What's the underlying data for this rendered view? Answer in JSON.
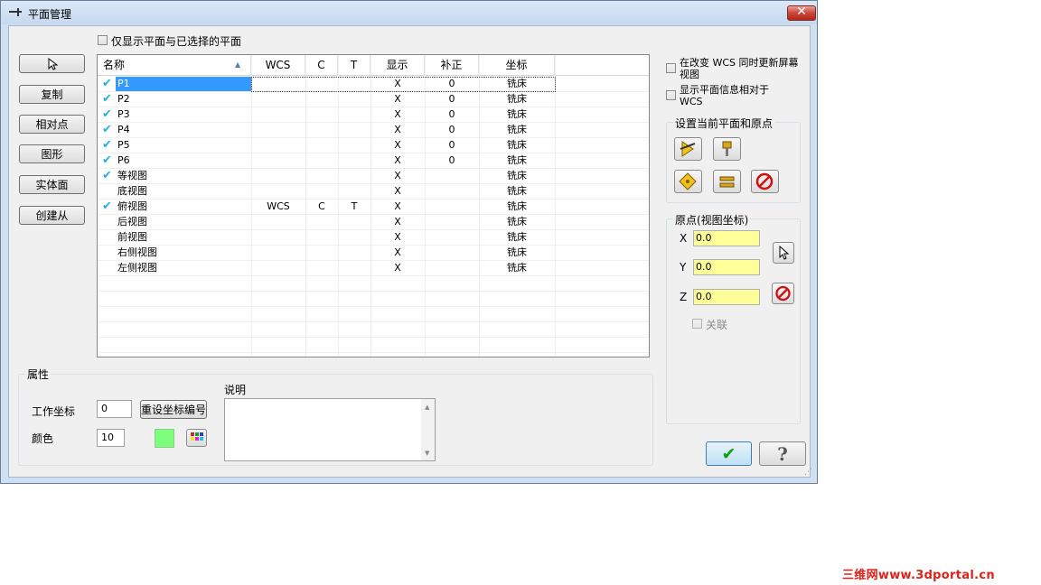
{
  "window": {
    "title": "平面管理",
    "close_symbol": "✕"
  },
  "filter_checkbox_label": "仅显示平面与已选择的平面",
  "left_buttons": {
    "copy": "复制",
    "relative_point": "相对点",
    "geometry": "图形",
    "solid_face": "实体面",
    "create_from": "创建从"
  },
  "table": {
    "columns": [
      "名称",
      "WCS",
      "C",
      "T",
      "显示",
      "补正",
      "坐标"
    ],
    "rows": [
      {
        "checked": true,
        "name": "P1",
        "wcs": "",
        "c": "",
        "t": "",
        "display": "X",
        "offset": "0",
        "coord": "铣床"
      },
      {
        "checked": true,
        "name": "P2",
        "wcs": "",
        "c": "",
        "t": "",
        "display": "X",
        "offset": "0",
        "coord": "铣床"
      },
      {
        "checked": true,
        "name": "P3",
        "wcs": "",
        "c": "",
        "t": "",
        "display": "X",
        "offset": "0",
        "coord": "铣床"
      },
      {
        "checked": true,
        "name": "P4",
        "wcs": "",
        "c": "",
        "t": "",
        "display": "X",
        "offset": "0",
        "coord": "铣床"
      },
      {
        "checked": true,
        "name": "P5",
        "wcs": "",
        "c": "",
        "t": "",
        "display": "X",
        "offset": "0",
        "coord": "铣床"
      },
      {
        "checked": true,
        "name": "P6",
        "wcs": "",
        "c": "",
        "t": "",
        "display": "X",
        "offset": "0",
        "coord": "铣床"
      },
      {
        "checked": true,
        "name": "等视图",
        "wcs": "",
        "c": "",
        "t": "",
        "display": "X",
        "offset": "",
        "coord": "铣床"
      },
      {
        "checked": false,
        "name": "底视图",
        "wcs": "",
        "c": "",
        "t": "",
        "display": "X",
        "offset": "",
        "coord": "铣床"
      },
      {
        "checked": true,
        "name": "俯视图",
        "wcs": "WCS",
        "c": "C",
        "t": "T",
        "display": "X",
        "offset": "",
        "coord": "铣床"
      },
      {
        "checked": false,
        "name": "后视图",
        "wcs": "",
        "c": "",
        "t": "",
        "display": "X",
        "offset": "",
        "coord": "铣床"
      },
      {
        "checked": false,
        "name": "前视图",
        "wcs": "",
        "c": "",
        "t": "",
        "display": "X",
        "offset": "",
        "coord": "铣床"
      },
      {
        "checked": false,
        "name": "右侧视图",
        "wcs": "",
        "c": "",
        "t": "",
        "display": "X",
        "offset": "",
        "coord": "铣床"
      },
      {
        "checked": false,
        "name": "左侧视图",
        "wcs": "",
        "c": "",
        "t": "",
        "display": "X",
        "offset": "",
        "coord": "铣床"
      }
    ],
    "selected_row": 0
  },
  "options": {
    "update_on_wcs_change": "在改变 WCS 同时更新屏幕视图",
    "display_relative_to_wcs": "显示平面信息相对于 WCS"
  },
  "set_current_group": {
    "title": "设置当前平面和原点"
  },
  "origin_group": {
    "title": "原点(视图坐标)",
    "x_label": "X",
    "y_label": "Y",
    "z_label": "Z",
    "x": "0.0",
    "y": "0.0",
    "z": "0.0",
    "link_label": "关联"
  },
  "properties": {
    "title": "属性",
    "work_coord_label": "工作坐标",
    "work_coord_value": "0",
    "reset_button": "重设坐标编号",
    "color_label": "颜色",
    "color_value": "10",
    "color_swatch": "#7dff7d",
    "description_label": "说明"
  },
  "ok_symbol": "✔",
  "help_symbol": "?",
  "watermark": "三维网www.3dportal.cn",
  "colors": {
    "selection": "#3399ff",
    "check": "#2aaee0",
    "watermark": "#e0201a"
  }
}
